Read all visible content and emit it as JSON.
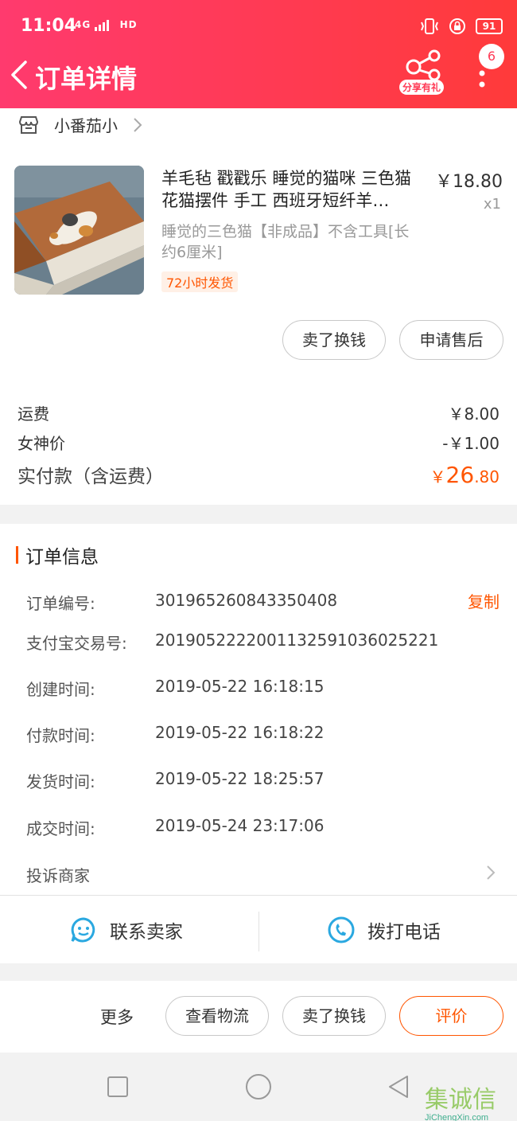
{
  "status": {
    "time": "11:04",
    "signal": "4G",
    "hd": "HD",
    "battery": "91"
  },
  "header": {
    "title": "订单详情",
    "share_label": "分享有礼",
    "badge_count": "6"
  },
  "shop": {
    "name": "小番茄小"
  },
  "product": {
    "title": "羊毛毡 戳戳乐 睡觉的猫咪 三色猫 花猫摆件 手工 西班牙短纤羊…",
    "price": "￥18.80",
    "qty": "x1",
    "spec": "睡觉的三色猫【非成品】不含工具[长约6厘米]",
    "ship_tag": "72小时发货",
    "btn_sell": "卖了换钱",
    "btn_aftersale": "申请售后"
  },
  "fees": {
    "shipping_label": "运费",
    "shipping_value": "￥8.00",
    "discount_label": "女神价",
    "discount_value": "-￥1.00",
    "total_label": "实付款（含运费）",
    "total_currency": "￥",
    "total_int": "26",
    "total_dec": ".80"
  },
  "order_info": {
    "title": "订单信息",
    "copy_label": "复制",
    "rows": [
      {
        "label": "订单编号:",
        "value": "301965260843350408"
      },
      {
        "label": "支付宝交易号:",
        "value": "2019052222001132591036025221"
      },
      {
        "label": "创建时间:",
        "value": "2019-05-22 16:18:15"
      },
      {
        "label": "付款时间:",
        "value": "2019-05-22 16:18:22"
      },
      {
        "label": "发货时间:",
        "value": "2019-05-22 18:25:57"
      },
      {
        "label": "成交时间:",
        "value": "2019-05-24 23:17:06"
      }
    ],
    "complain_label": "投诉商家",
    "contact_seller": "联系卖家",
    "call_phone": "拨打电话"
  },
  "actions": {
    "more": "更多",
    "logistics": "查看物流",
    "sell": "卖了换钱",
    "review": "评价"
  },
  "watermark": {
    "main": "集诚信",
    "sub": "JiChengXin.com"
  },
  "colors": {
    "accent": "#ff5500",
    "header_start": "#ff3a6e",
    "header_end": "#ff3a3a",
    "contact_icon": "#2aa8e0"
  }
}
